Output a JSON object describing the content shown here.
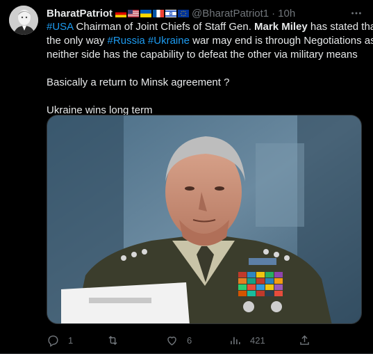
{
  "author": {
    "display_name": "BharatPatriot",
    "handle": "@BharatPatriot1",
    "separator": "·",
    "time": "10h",
    "flags": [
      "germany-flag",
      "usa-flag",
      "ukraine-flag",
      "france-flag",
      "israel-flag",
      "eu-flag"
    ]
  },
  "tweet": {
    "line1": {
      "tag1": "#USA",
      "t1": " Chairman of Joint Chiefs of Staff Gen. ",
      "bold": "Mark Miley",
      "t2": " has stated that"
    },
    "line2": {
      "t1": "the only way ",
      "tag1": "#Russia",
      "sp": " ",
      "tag2": "#Ukraine",
      "t2": " war may end is through Negotiations as"
    },
    "line3": "neither side has the capability to defeat the other via military means",
    "line4": "Basically a return to Minsk agreement ?",
    "line5": "Ukraine wins long term"
  },
  "actions": {
    "replies": "1",
    "retweets": "",
    "likes": "6",
    "views": "421"
  },
  "colors": {
    "background": "#000000",
    "text": "#e7e9ea",
    "muted": "#71767b",
    "link": "#1d9bf0",
    "border": "#2f3336"
  },
  "icons": [
    "more-icon",
    "reply-icon",
    "retweet-icon",
    "like-icon",
    "views-icon",
    "share-icon"
  ]
}
